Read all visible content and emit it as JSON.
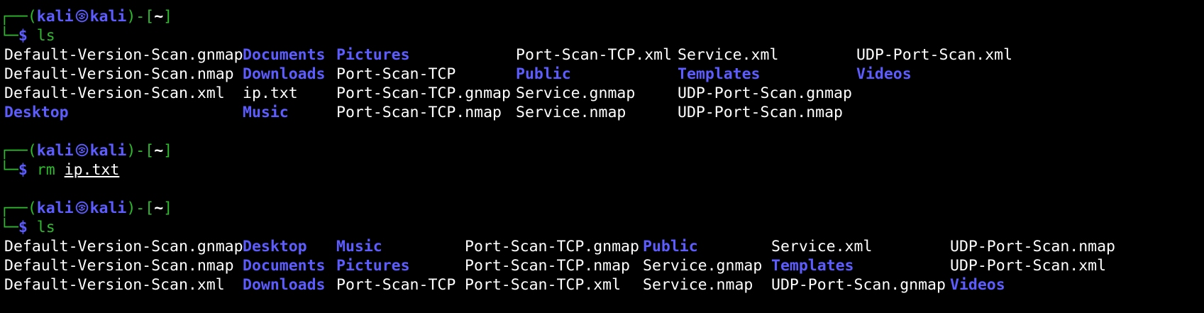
{
  "terminal": {
    "prompt": {
      "corner_top": "┌──(",
      "user": "kali",
      "host": "kali",
      "close_paren": ")-[",
      "cwd": "~",
      "close_bracket": "]",
      "corner_bottom": "└─",
      "dollar": "$"
    },
    "blocks": [
      {
        "command": "ls",
        "args": "",
        "output_columns": [
          {
            "entries": [
              {
                "name": "Default-Version-Scan.gnmap",
                "dir": false
              },
              {
                "name": "Default-Version-Scan.nmap",
                "dir": false
              },
              {
                "name": "Default-Version-Scan.xml",
                "dir": false
              },
              {
                "name": "Desktop",
                "dir": true
              }
            ]
          },
          {
            "entries": [
              {
                "name": "Documents",
                "dir": true
              },
              {
                "name": "Downloads",
                "dir": true
              },
              {
                "name": "ip.txt",
                "dir": false
              },
              {
                "name": "Music",
                "dir": true
              }
            ]
          },
          {
            "entries": [
              {
                "name": "Pictures",
                "dir": true
              },
              {
                "name": "Port-Scan-TCP",
                "dir": false
              },
              {
                "name": "Port-Scan-TCP.gnmap",
                "dir": false
              },
              {
                "name": "Port-Scan-TCP.nmap",
                "dir": false
              }
            ]
          },
          {
            "entries": [
              {
                "name": "Port-Scan-TCP.xml",
                "dir": false
              },
              {
                "name": "Public",
                "dir": true
              },
              {
                "name": "Service.gnmap",
                "dir": false
              },
              {
                "name": "Service.nmap",
                "dir": false
              }
            ]
          },
          {
            "entries": [
              {
                "name": "Service.xml",
                "dir": false
              },
              {
                "name": "Templates",
                "dir": true
              },
              {
                "name": "UDP-Port-Scan.gnmap",
                "dir": false
              },
              {
                "name": "UDP-Port-Scan.nmap",
                "dir": false
              }
            ]
          },
          {
            "entries": [
              {
                "name": "UDP-Port-Scan.xml",
                "dir": false
              },
              {
                "name": "Videos",
                "dir": true
              }
            ]
          }
        ]
      },
      {
        "command": "rm",
        "args": "ip.txt",
        "output_columns": []
      },
      {
        "command": "ls",
        "args": "",
        "output_columns": [
          {
            "entries": [
              {
                "name": "Default-Version-Scan.gnmap",
                "dir": false
              },
              {
                "name": "Default-Version-Scan.nmap",
                "dir": false
              },
              {
                "name": "Default-Version-Scan.xml",
                "dir": false
              }
            ]
          },
          {
            "entries": [
              {
                "name": "Desktop",
                "dir": true
              },
              {
                "name": "Documents",
                "dir": true
              },
              {
                "name": "Downloads",
                "dir": true
              }
            ]
          },
          {
            "entries": [
              {
                "name": "Music",
                "dir": true
              },
              {
                "name": "Pictures",
                "dir": true
              },
              {
                "name": "Port-Scan-TCP",
                "dir": false
              }
            ]
          },
          {
            "entries": [
              {
                "name": "Port-Scan-TCP.gnmap",
                "dir": false
              },
              {
                "name": "Port-Scan-TCP.nmap",
                "dir": false
              },
              {
                "name": "Port-Scan-TCP.xml",
                "dir": false
              }
            ]
          },
          {
            "entries": [
              {
                "name": "Public",
                "dir": true
              },
              {
                "name": "Service.gnmap",
                "dir": false
              },
              {
                "name": "Service.nmap",
                "dir": false
              }
            ]
          },
          {
            "entries": [
              {
                "name": "Service.xml",
                "dir": false
              },
              {
                "name": "Templates",
                "dir": true
              },
              {
                "name": "UDP-Port-Scan.gnmap",
                "dir": false
              }
            ]
          },
          {
            "entries": [
              {
                "name": "UDP-Port-Scan.nmap",
                "dir": false
              },
              {
                "name": "UDP-Port-Scan.xml",
                "dir": false
              },
              {
                "name": "Videos",
                "dir": true
              }
            ]
          }
        ]
      }
    ],
    "colors": {
      "background": "#000000",
      "prompt_green": "#2dbb2d",
      "user_blue": "#5c5cff",
      "directory_blue": "#5c5cff",
      "text_white": "#ffffff"
    },
    "icons": {
      "user_host_separator": "kali-skull-icon"
    }
  }
}
